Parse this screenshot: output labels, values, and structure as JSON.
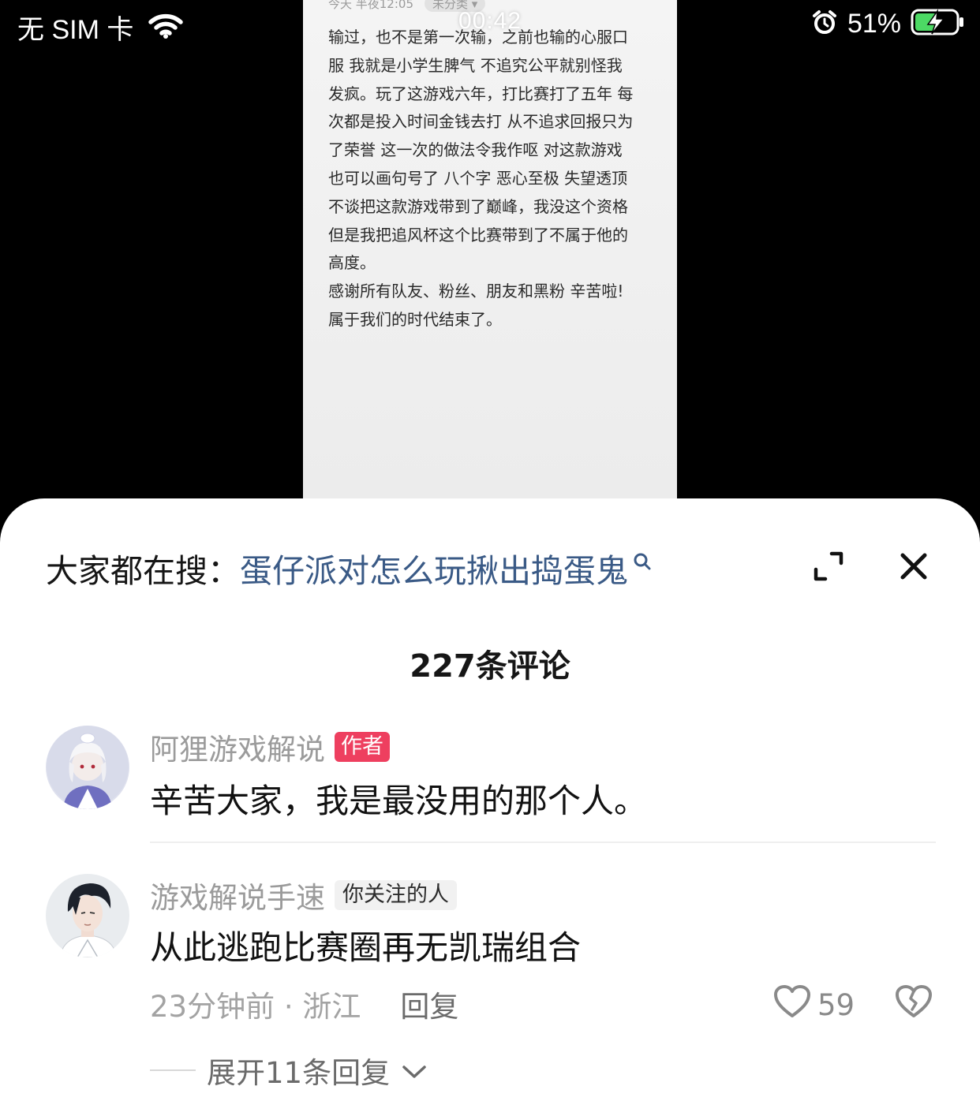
{
  "status_bar": {
    "carrier": "无 SIM 卡",
    "battery": "51%"
  },
  "video": {
    "playback_time": "00:42",
    "note_meta_time": "今天 半夜12:05",
    "note_meta_category": "未分类 ▾",
    "note_text": "输过，也不是第一次输，之前也输的心服口\n服 我就是小学生脾气 不追究公平就别怪我\n发疯。玩了这游戏六年，打比赛打了五年 每\n次都是投入时间金钱去打 从不追求回报只为\n了荣誉 这一次的做法令我作呕 对这款游戏\n也可以画句号了 八个字 恶心至极 失望透顶\n不谈把这款游戏带到了巅峰，我没这个资格\n但是我把追风杯这个比赛带到了不属于他的\n高度。\n感谢所有队友、粉丝、朋友和黑粉 辛苦啦!\n属于我们的时代结束了。"
  },
  "sheet": {
    "search_prefix": "大家都在搜：",
    "search_term": "蛋仔派对怎么玩揪出捣蛋鬼",
    "comment_count": "227条评论",
    "comments": [
      {
        "author": "阿狸游戏解说",
        "badge": "作者",
        "text": "辛苦大家，我是最没用的那个人。"
      },
      {
        "author": "游戏解说手速",
        "badge": "你关注的人",
        "text": "从此逃跑比赛圈再无凯瑞组合",
        "time_location": "23分钟前 · 浙江",
        "reply_label": "回复",
        "likes": "59",
        "expand_replies": "展开11条回复"
      }
    ]
  },
  "colors": {
    "search_term": "#3a5a86",
    "author_badge": "#ee3f5f",
    "follow_badge_bg": "#f1f1f1"
  }
}
